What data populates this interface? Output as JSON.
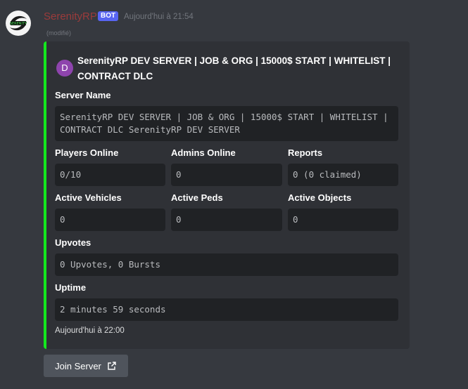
{
  "message": {
    "username": "SerenityRP",
    "bot_tag": "BOT",
    "timestamp": "Aujourd'hui à 21:54",
    "edited": "(modifié)",
    "avatar_icon": "serenity-logo-icon"
  },
  "embed": {
    "accent_color": "#14e81e",
    "author_initial": "D",
    "title": "SerenityRP DEV SERVER | JOB & ORG | 15000$ START | WHITELIST | CONTRACT DLC",
    "fields": {
      "server_name": {
        "name": "Server Name",
        "value": "SerenityRP DEV SERVER | JOB & ORG | 15000$ START | WHITELIST | CONTRACT DLC SerenityRP DEV SERVER"
      },
      "players_online": {
        "name": "Players Online",
        "value": "0/10"
      },
      "admins_online": {
        "name": "Admins Online",
        "value": "0"
      },
      "reports": {
        "name": "Reports",
        "value": "0 (0 claimed)"
      },
      "active_vehicles": {
        "name": "Active Vehicles",
        "value": "0"
      },
      "active_peds": {
        "name": "Active Peds",
        "value": "0"
      },
      "active_objects": {
        "name": "Active Objects",
        "value": "0"
      },
      "upvotes": {
        "name": "Upvotes",
        "value": "0 Upvotes, 0 Bursts"
      },
      "uptime": {
        "name": "Uptime",
        "value": "2 minutes 59 seconds"
      }
    },
    "footer": "Aujourd'hui à 22:00"
  },
  "button": {
    "label": "Join Server",
    "icon": "external-link-icon"
  }
}
